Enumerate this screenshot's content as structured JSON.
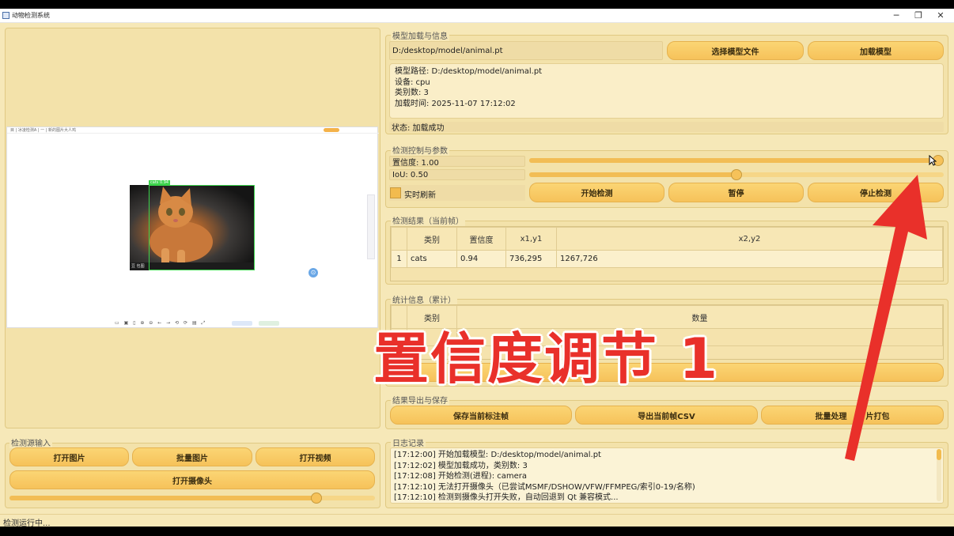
{
  "window": {
    "title": "动物检测系统",
    "min": "─",
    "max": "❐",
    "close": "✕"
  },
  "preview": {
    "browser_tab": "目 | 冰凌检测A | 一 | 新的图片大人鸡",
    "box_label": "cats 0.94",
    "image_watermark": "豆 包图",
    "toolbar_glyphs": "▭ ▣ ▯ ⊕ ⊖ ← → ⟲ ⟳ ▤ ⤢",
    "floating_badge": "⊙"
  },
  "model": {
    "section": "模型加载与信息",
    "path": "D:/desktop/model/animal.pt",
    "select_btn": "选择模型文件",
    "load_btn": "加载模型",
    "info": [
      "模型路径: D:/desktop/model/animal.pt",
      "设备: cpu",
      "类别数: 3",
      "加载时间: 2025-11-07 17:12:02"
    ],
    "status": "状态: 加载成功"
  },
  "control": {
    "section": "检测控制与参数",
    "conf_label": "置信度: 1.00",
    "conf_value": 1.0,
    "iou_label": "IoU: 0.50",
    "iou_value": 0.5,
    "realtime": "实时刷新",
    "start": "开始检测",
    "pause": "暂停",
    "stop": "停止检测"
  },
  "results": {
    "section": "检测结果（当前帧）",
    "headers": [
      "",
      "类别",
      "置信度",
      "x1,y1",
      "x2,y2"
    ],
    "rows": [
      [
        "1",
        "cats",
        "0.94",
        "736,295",
        "1267,726"
      ]
    ]
  },
  "stats": {
    "section": "统计信息（累计）",
    "headers": [
      "",
      "类别",
      "数量"
    ]
  },
  "export": {
    "section": "结果导出与保存",
    "save_btn": "保存当前标注帧",
    "csv_btn": "导出当前帧CSV",
    "batch_btn": "批量处理",
    "batch_btn_tail": "片打包"
  },
  "log": {
    "section": "日志记录",
    "lines": [
      "[17:12:00] 开始加载模型: D:/desktop/model/animal.pt",
      "[17:12:02] 模型加载成功，类别数: 3",
      "[17:12:08] 开始检测(进程): camera",
      "[17:12:10] 无法打开摄像头（已尝试MSMF/DSHOW/VFW/FFMPEG/索引0-19/名称)",
      "[17:12:10] 检测到摄像头打开失败，自动回退到 Qt 兼容模式..."
    ]
  },
  "source": {
    "section": "检测源输入",
    "open_image": "打开图片",
    "batch_image": "批量图片",
    "open_video": "打开视频",
    "open_camera": "打开摄像头",
    "progress": 0.84
  },
  "status_bar": "检测运行中...",
  "overlay": {
    "caption": "置信度调节 1"
  },
  "colors": {
    "accent": "#f6c25a",
    "overlay_red": "#e9302a",
    "panel_bg": "#f3e2aa"
  }
}
